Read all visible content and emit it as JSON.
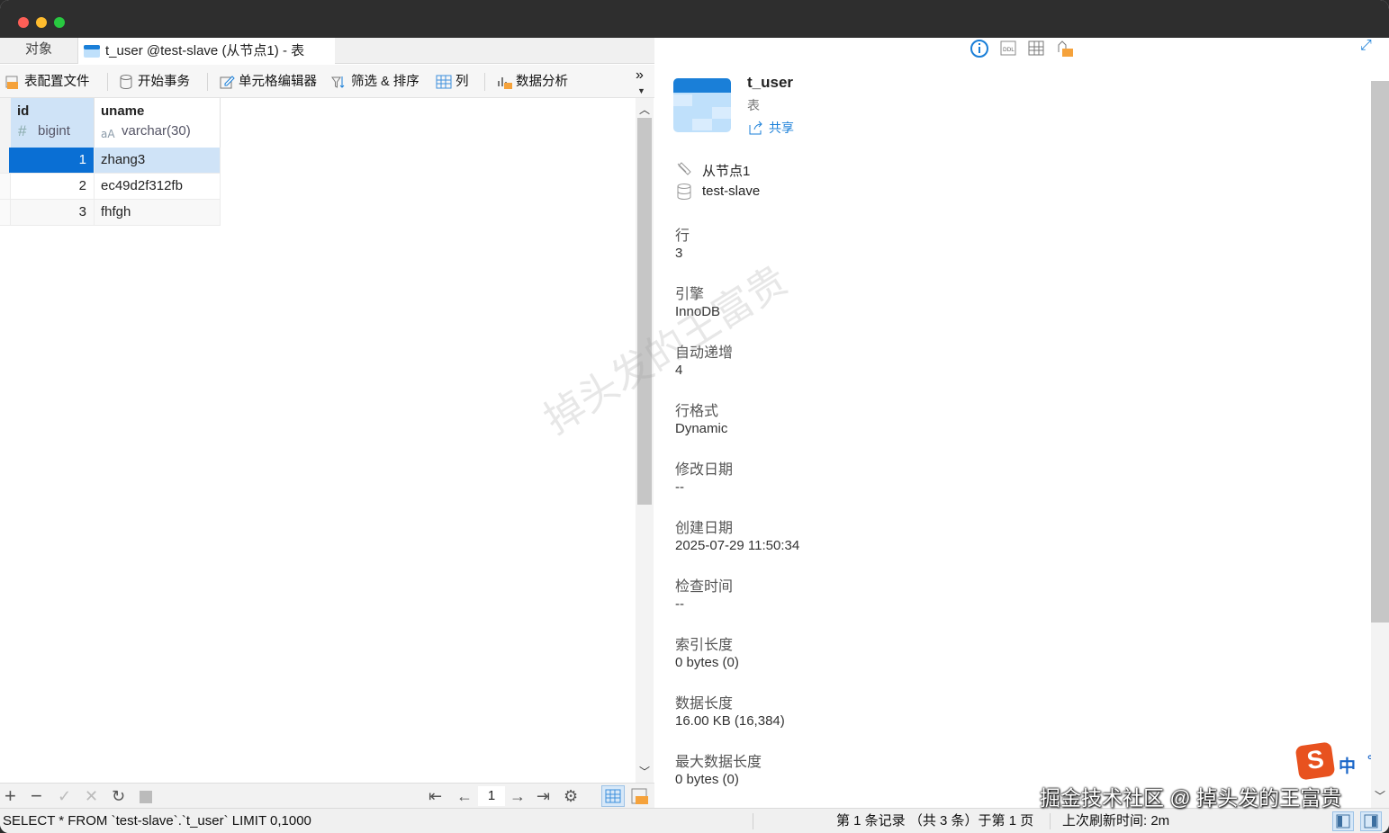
{
  "tabs": {
    "objects": "对象",
    "active": "t_user @test-slave (从节点1) - 表"
  },
  "toolbar": {
    "profile": "表配置文件",
    "begin_tx": "开始事务",
    "cell_editor": "单元格编辑器",
    "filter_sort": "筛选 & 排序",
    "columns": "列",
    "analysis": "数据分析",
    "more": "»"
  },
  "grid": {
    "columns": [
      {
        "name": "id",
        "type": "bigint",
        "type_icon": "hash-icon"
      },
      {
        "name": "uname",
        "type": "varchar(30)",
        "type_icon": "text-type-icon"
      }
    ],
    "rows": [
      {
        "id": "1",
        "uname": "zhang3",
        "selected": true
      },
      {
        "id": "2",
        "uname": "ec49d2f312fb",
        "selected": false
      },
      {
        "id": "3",
        "uname": "fhfgh",
        "selected": false
      }
    ]
  },
  "pager": {
    "page": "1"
  },
  "status": {
    "sql": "SELECT * FROM `test-slave`.`t_user` LIMIT 0,1000",
    "records": "第 1 条记录 （共 3 条）于第 1 页",
    "refresh": "上次刷新时间: 2m"
  },
  "info": {
    "name": "t_user",
    "kind": "表",
    "share": "共享",
    "connection": "从节点1",
    "database": "test-slave",
    "fields": [
      {
        "label": "行",
        "value": "3"
      },
      {
        "label": "引擎",
        "value": "InnoDB"
      },
      {
        "label": "自动递增",
        "value": "4"
      },
      {
        "label": "行格式",
        "value": "Dynamic"
      },
      {
        "label": "修改日期",
        "value": "--"
      },
      {
        "label": "创建日期",
        "value": "2025-07-29 11:50:34"
      },
      {
        "label": "检查时间",
        "value": "--"
      },
      {
        "label": "索引长度",
        "value": "0 bytes (0)"
      },
      {
        "label": "数据长度",
        "value": "16.00 KB (16,384)"
      },
      {
        "label": "最大数据长度",
        "value": "0 bytes (0)"
      }
    ]
  },
  "ime": {
    "mode": "中",
    "punct": "°,"
  },
  "watermark": "掉头发的王富贵",
  "credit": "掘金技术社区 @ 掉头发的王富贵",
  "colors": {
    "accent": "#1a7fd8",
    "selected_row": "#cfe3f7",
    "selected_cell": "#0a6fd4",
    "header_id": "#cfe3f7"
  }
}
